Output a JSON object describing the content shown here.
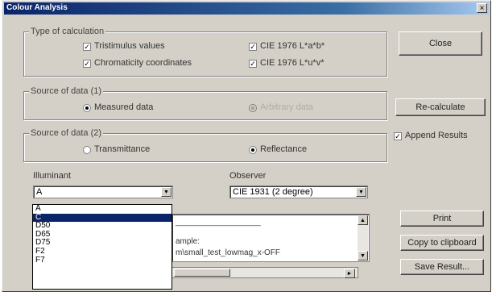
{
  "window": {
    "title": "Colour Analysis",
    "close_glyph": "×"
  },
  "calc_group": {
    "legend": "Type of calculation",
    "options": [
      {
        "label": "Tristimulus values",
        "checked": true
      },
      {
        "label": "Chromaticity coordinates",
        "checked": true
      },
      {
        "label": "CIE 1976 L*a*b*",
        "checked": true
      },
      {
        "label": "CIE 1976 L*u*v*",
        "checked": true
      }
    ]
  },
  "source1_group": {
    "legend": "Source of data (1)",
    "options": [
      {
        "label": "Measured data",
        "selected": true,
        "enabled": true
      },
      {
        "label": "Arbitrary data",
        "selected": true,
        "enabled": false
      }
    ]
  },
  "source2_group": {
    "legend": "Source of data (2)",
    "options": [
      {
        "label": "Transmittance",
        "selected": false
      },
      {
        "label": "Reflectance",
        "selected": true
      }
    ]
  },
  "illuminant": {
    "label": "Illuminant",
    "value": "A",
    "options": [
      "A",
      "C",
      "D50",
      "D65",
      "D75",
      "F2",
      "F7"
    ],
    "highlighted": "C"
  },
  "observer": {
    "label": "Observer",
    "value": "CIE 1931 (2 degree)"
  },
  "results_text": {
    "line1": "___________________",
    "line2": "ample:",
    "line3": "m\\small_test_lowmag_x-OFF"
  },
  "buttons": {
    "close": "Close",
    "recalculate": "Re-calculate",
    "print": "Print",
    "copy": "Copy to clipboard",
    "save": "Save Result..."
  },
  "append_results": {
    "label": "Append Results",
    "checked": true
  },
  "check_glyph": "✓",
  "arrow_down": "▼",
  "arrow_up": "▲",
  "arrow_right": "►"
}
